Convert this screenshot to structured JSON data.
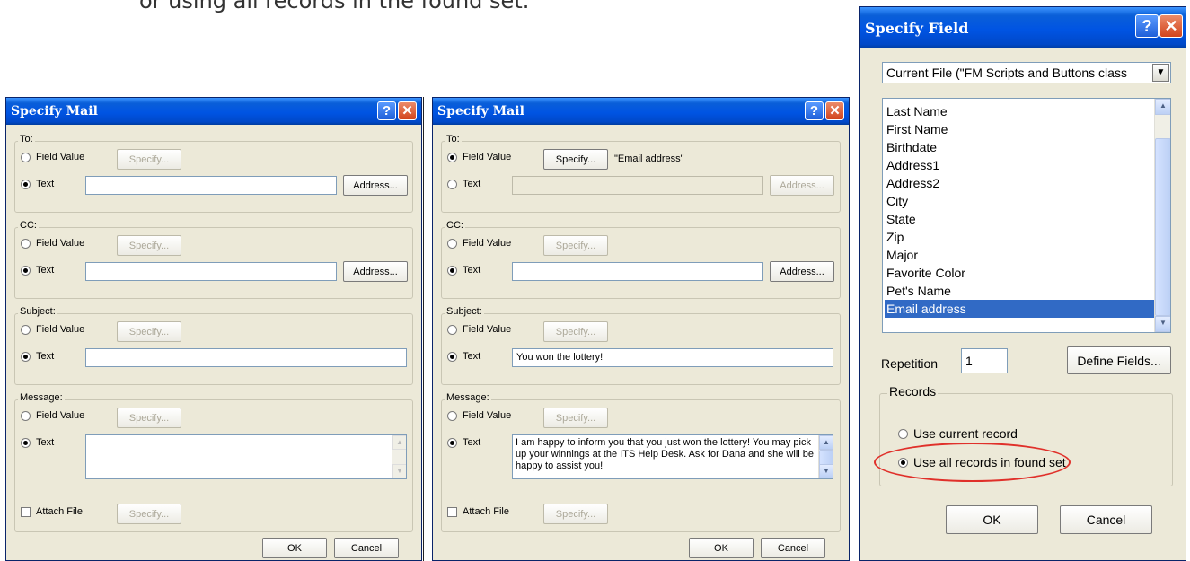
{
  "intro_text": "or using all records in the found set.",
  "dialog1": {
    "title": "Specify Mail",
    "to": {
      "label": "To:",
      "field_value_label": "Field Value",
      "specify_label": "Specify...",
      "text_label": "Text",
      "text_value": "",
      "address_label": "Address...",
      "selected": "text"
    },
    "cc": {
      "label": "CC:",
      "field_value_label": "Field Value",
      "specify_label": "Specify...",
      "text_label": "Text",
      "text_value": "",
      "address_label": "Address...",
      "selected": "text"
    },
    "subject": {
      "label": "Subject:",
      "field_value_label": "Field Value",
      "specify_label": "Specify...",
      "text_label": "Text",
      "text_value": "",
      "selected": "text"
    },
    "message": {
      "label": "Message:",
      "field_value_label": "Field Value",
      "specify_label": "Specify...",
      "text_label": "Text",
      "text_value": "",
      "selected": "text"
    },
    "attach_file_label": "Attach File",
    "attach_specify_label": "Specify...",
    "ok_label": "OK",
    "cancel_label": "Cancel"
  },
  "dialog2": {
    "title": "Specify Mail",
    "to": {
      "label": "To:",
      "field_value_label": "Field Value",
      "specify_label": "Specify...",
      "field_name": "\"Email address\"",
      "text_label": "Text",
      "text_value": "",
      "address_label": "Address...",
      "selected": "field_value"
    },
    "cc": {
      "label": "CC:",
      "field_value_label": "Field Value",
      "specify_label": "Specify...",
      "text_label": "Text",
      "text_value": "",
      "address_label": "Address...",
      "selected": "text"
    },
    "subject": {
      "label": "Subject:",
      "field_value_label": "Field Value",
      "specify_label": "Specify...",
      "text_label": "Text",
      "text_value": "You won the lottery!",
      "selected": "text"
    },
    "message": {
      "label": "Message:",
      "field_value_label": "Field Value",
      "specify_label": "Specify...",
      "text_label": "Text",
      "text_value": "I am happy to inform you that you just won the lottery!  You may pick up your winnings at the ITS Help Desk.  Ask for Dana and she will be happy to assist you!",
      "selected": "text"
    },
    "attach_file_label": "Attach File",
    "attach_specify_label": "Specify...",
    "ok_label": "OK",
    "cancel_label": "Cancel"
  },
  "dialog3": {
    "title": "Specify Field",
    "file_dropdown": "Current File (\"FM Scripts and Buttons class",
    "fields": [
      "Last Name",
      "First Name",
      "Birthdate",
      "Address1",
      "Address2",
      "City",
      "State",
      "Zip",
      "Major",
      "Favorite Color",
      "Pet's Name",
      "Email address"
    ],
    "selected_field": "Email address",
    "repetition_label": "Repetition",
    "repetition_value": "1",
    "define_fields_label": "Define Fields...",
    "records_label": "Records",
    "use_current_label": "Use current record",
    "use_all_label": "Use all records in found set",
    "selected_records_option": "use_all",
    "ok_label": "OK",
    "cancel_label": "Cancel"
  },
  "colors": {
    "dialog_bg": "#ece9d8",
    "titlebar": "#0054e3",
    "selection": "#316ac5",
    "highlight_ellipse": "#e0302a"
  }
}
